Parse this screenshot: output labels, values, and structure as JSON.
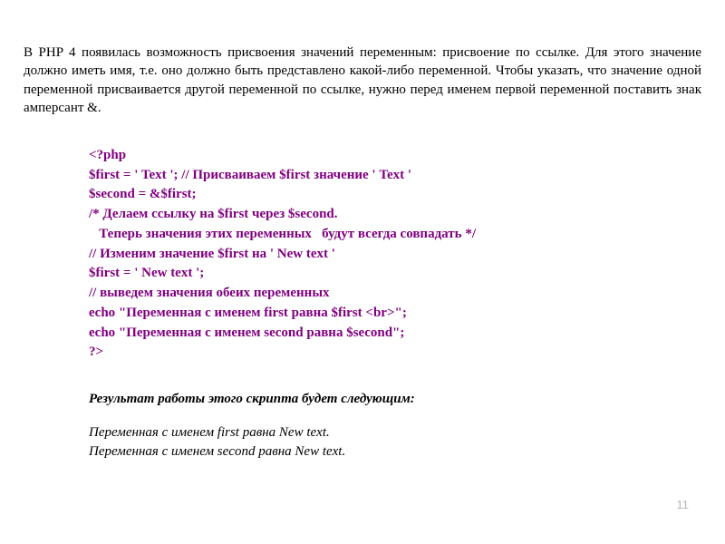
{
  "intro": "В PHP 4 появилась возможность присвоения значений переменным: присвоение по ссылке. Для этого значение должно иметь имя, т.е. оно должно быть представлено какой-либо переменной. Чтобы указать, что значение одной переменной присваивается другой переменной по ссылке, нужно перед именем первой переменной поставить знак амперсант &.",
  "code": {
    "l1": "<?php",
    "l2": "$first = ' Text '; // Присваиваем $first значение ' Text '",
    "l3": "$second = &$first;",
    "l4": "/* Делаем ссылку на $first через $second.",
    "l5": "   Теперь значения этих переменных   будут всегда совпадать */",
    "l6": "// Изменим значение $first на ' New text '",
    "l7": "$first = ' New text ';",
    "l8": "// выведем значения обеих переменных",
    "l9": "echo \"Переменная с именем first равна $first <br>\";",
    "l10": "echo \"Переменная с именем second равна $second\";",
    "l11": "?>"
  },
  "result_heading": "Результат работы этого скрипта будет следующим:",
  "result_line1": "Переменная с именем first равна New text.",
  "result_line2": "Переменная с именем second равна New text.",
  "page_number": "11"
}
